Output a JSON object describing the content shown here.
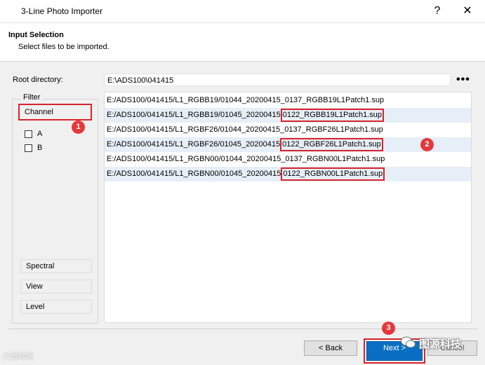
{
  "window": {
    "title": "3-Line Photo Importer",
    "help_glyph": "?",
    "close_glyph": "✕"
  },
  "header": {
    "title": "Input Selection",
    "subtitle": "Select files to be imported."
  },
  "root": {
    "label": "Root directory:",
    "value": "E:\\ADS100\\041415",
    "browse_glyph": "•••"
  },
  "filter": {
    "legend": "Filter",
    "channel_label": "Channel",
    "channel_options": [
      {
        "label": "A",
        "checked": false
      },
      {
        "label": "B",
        "checked": false
      }
    ],
    "spectral_label": "Spectral",
    "view_label": "View",
    "level_label": "Level"
  },
  "files": [
    {
      "prefix": "E:/ADS100/041415/L1_RGBB19/01044_20200415_0137_RGBB19L1Patch1.sup",
      "highlight": ""
    },
    {
      "prefix": "E:/ADS100/041415/L1_RGBB19/01045_20200415",
      "highlight": "0122_RGBB19L1Patch1.sup"
    },
    {
      "prefix": "E:/ADS100/041415/L1_RGBF26/01044_20200415_0137_RGBF26L1Patch1.sup",
      "highlight": ""
    },
    {
      "prefix": "E:/ADS100/041415/L1_RGBF26/01045_20200415",
      "highlight": "0122_RGBF26L1Patch1.sup"
    },
    {
      "prefix": "E:/ADS100/041415/L1_RGBN00/01044_20200415_0137_RGBN00L1Patch1.sup",
      "highlight": ""
    },
    {
      "prefix": "E:/ADS100/041415/L1_RGBN00/01045_20200415",
      "highlight": "0122_RGBN00L1Patch1.sup"
    }
  ],
  "badges": [
    "1",
    "2",
    "3"
  ],
  "buttons": {
    "back": "< Back",
    "next": "Next >",
    "cancel": "Cancel"
  },
  "watermarks": {
    "right": "图源科技",
    "left": "大数跨境"
  },
  "colors": {
    "highlight_red": "#d9232d",
    "primary_blue": "#0a6fc2",
    "selected_row": "#e6eef7"
  }
}
